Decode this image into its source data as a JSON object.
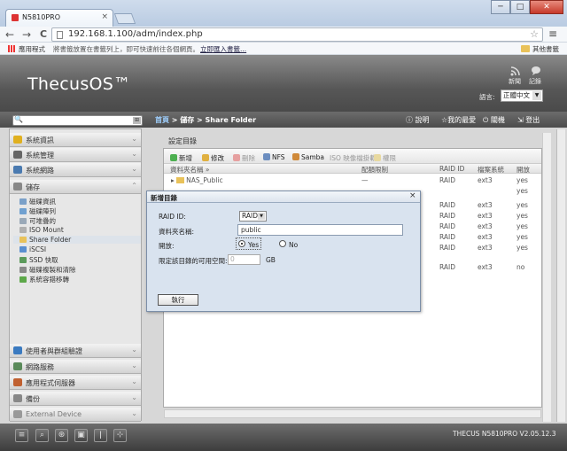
{
  "browser": {
    "tab_title": "N5810PRO",
    "tab_close": "×",
    "url": "192.168.1.100/adm/index.php",
    "back": "←",
    "forward": "→",
    "reload": "C",
    "menu": "≡",
    "star": "☆",
    "win_min": "─",
    "win_max": "□",
    "win_close": "✕",
    "bookmarks": {
      "apps_label": "應用程式",
      "hint": "將書籤放置在書籤列上，即可快速前往各個網頁。",
      "import_link": "立即匯入書籤...",
      "other_label": "其他書籤"
    }
  },
  "header": {
    "logo": "ThecusOS™",
    "news_label": "新聞",
    "log_label": "記錄",
    "lang_label": "語言:",
    "lang_value": "正體中文"
  },
  "menubar": {
    "breadcrumb_home": "首頁",
    "breadcrumb_rest": " > 儲存 > Share Folder",
    "help": "說明",
    "favorites": "我的最愛",
    "shutdown": "關機",
    "logout": "登出"
  },
  "sidebar": {
    "sections_top": [
      {
        "label": "系統資訊",
        "color": "#e0b020"
      },
      {
        "label": "系統管理",
        "color": "#666666"
      },
      {
        "label": "系統網路",
        "color": "#4a7ab0"
      },
      {
        "label": "儲存",
        "color": "#888888"
      }
    ],
    "storage_items": [
      {
        "label": "磁碟資訊",
        "color": "#7aa0c8",
        "disabled": false
      },
      {
        "label": "磁碟陣列",
        "color": "#6fa0d0",
        "disabled": false
      },
      {
        "label": "可堆疊的",
        "color": "#9aa9b8",
        "disabled": false
      },
      {
        "label": "ISO Mount",
        "color": "#b0b0b0",
        "disabled": false
      },
      {
        "label": "Share Folder",
        "color": "#e9c25a",
        "disabled": false,
        "selected": true
      },
      {
        "label": "iSCSI",
        "color": "#5a8fd0",
        "disabled": false
      },
      {
        "label": "SSD 快取",
        "color": "#5b9a5b",
        "disabled": false
      },
      {
        "label": "磁碟複製和清除",
        "color": "#8a8a8a",
        "disabled": false
      },
      {
        "label": "系統容錯移轉",
        "color": "#5da84a",
        "disabled": false
      }
    ],
    "sections_bottom": [
      {
        "label": "使用者與群組驗證",
        "color": "#3a7ac0"
      },
      {
        "label": "網路服務",
        "color": "#5a8a5a"
      },
      {
        "label": "應用程式伺服器",
        "color": "#c06030"
      },
      {
        "label": "備份",
        "color": "#888888"
      },
      {
        "label": "External Device",
        "color": "#999999"
      }
    ]
  },
  "main": {
    "panel_title": "設定目錄",
    "toolbar": [
      "新增",
      "修改",
      "刪除",
      "NFS",
      "Samba",
      "ISO 映像檔掛載",
      "權限"
    ],
    "columns": [
      "資料夾名稱 »",
      "配額限制",
      "RAID ID",
      "檔案系統",
      "開放"
    ],
    "rows": [
      {
        "name": "NAS_Public",
        "quota": "—",
        "raid": "RAID",
        "fs": "ext3",
        "public": "yes"
      },
      {
        "name": "",
        "quota": "",
        "raid": "",
        "fs": "",
        "public": "yes"
      },
      {
        "name": "",
        "quota": "",
        "raid": "RAID",
        "fs": "ext3",
        "public": "yes"
      },
      {
        "name": "",
        "quota": "",
        "raid": "RAID",
        "fs": "ext3",
        "public": "yes"
      },
      {
        "name": "",
        "quota": "",
        "raid": "RAID",
        "fs": "ext3",
        "public": "yes"
      },
      {
        "name": "",
        "quota": "",
        "raid": "RAID",
        "fs": "ext3",
        "public": "yes"
      },
      {
        "name": "",
        "quota": "",
        "raid": "RAID",
        "fs": "ext3",
        "public": "yes"
      },
      {
        "name": "",
        "quota": "",
        "raid": "RAID",
        "fs": "ext3",
        "public": "no"
      }
    ]
  },
  "dialog": {
    "title": "新增目錄",
    "close": "×",
    "raid_label": "RAID ID:",
    "raid_value": "RAID",
    "name_label": "資料夾名稱:",
    "name_value": "public",
    "public_label": "開放:",
    "yes_label": "Yes",
    "no_label": "No",
    "public_selected": "Yes",
    "quota_label": "限定該目錄的可用空間:",
    "quota_value": "0",
    "quota_unit": "GB",
    "execute": "執行"
  },
  "footer": {
    "version": "THECUS N5810PRO V2.05.12.3"
  }
}
